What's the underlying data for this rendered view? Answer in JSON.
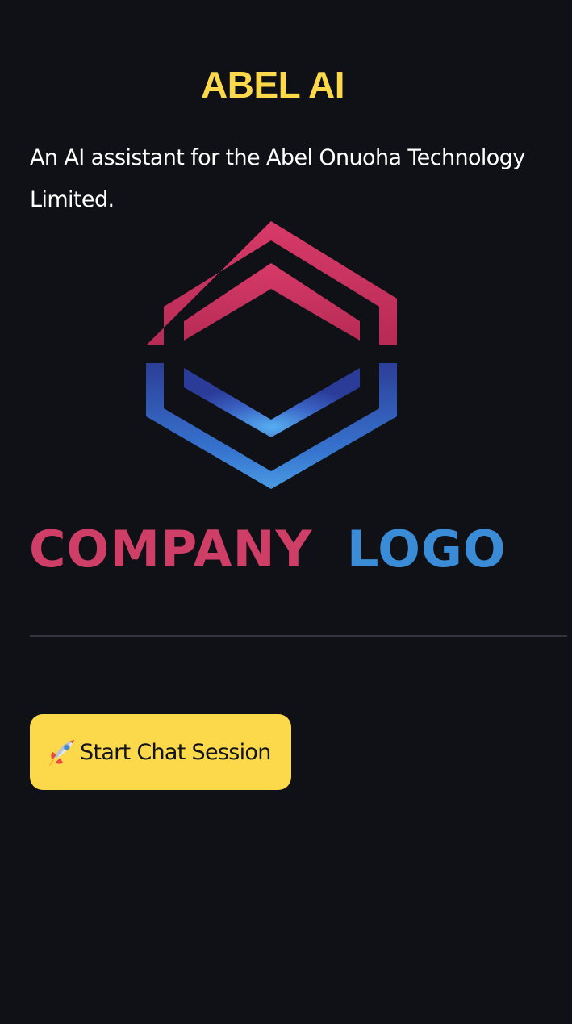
{
  "header": {
    "title": "ABEL AI",
    "subtitle": "An AI assistant for the Abel Onuoha Technology Limited."
  },
  "logo": {
    "word_left": "COMPANY",
    "word_right": "LOGO",
    "icon": "hexagon-logo-icon"
  },
  "action": {
    "start_label": "Start Chat Session",
    "icon": "rocket-icon"
  },
  "colors": {
    "background": "#0f1116",
    "accent": "#fcd94a",
    "text": "#ffffff",
    "logo_red": "#cf3e66",
    "logo_blue": "#3b8cd6",
    "divider": "#33363f"
  }
}
